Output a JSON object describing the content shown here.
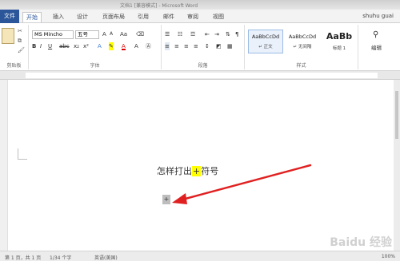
{
  "title_bar": {
    "title": "文档1 [兼容模式] - Microsoft Word"
  },
  "tabs": {
    "file": "文件",
    "items": [
      "开始",
      "插入",
      "设计",
      "页面布局",
      "引用",
      "邮件",
      "审阅",
      "视图"
    ],
    "active": "开始",
    "user": "shuhu guai"
  },
  "ribbon": {
    "clipboard_label": "剪贴板",
    "font_name": "MS Mincho",
    "font_size": "五号",
    "font_label": "字体",
    "paragraph_label": "段落",
    "styles": [
      {
        "sample": "AaBbCcDd",
        "name": "↵ 正文"
      },
      {
        "sample": "AaBbCcDd",
        "name": "↵ 无间隔"
      },
      {
        "sample": "AaBb",
        "name": "标题 1"
      }
    ],
    "styles_label": "样式",
    "edit_label": "编辑"
  },
  "document": {
    "line_before": "怎样打出",
    "line_highlight": "+",
    "line_after": "符号",
    "mark": "+"
  },
  "status": {
    "page": "第 1 页，共 1 页",
    "words": "1/34 个字",
    "lang": "英语(美国)",
    "zoom": "100%"
  },
  "watermark": "Baidu 经验",
  "colors": {
    "accent": "#2b579a",
    "highlight": "#ffff00",
    "arrow": "#e02020"
  }
}
